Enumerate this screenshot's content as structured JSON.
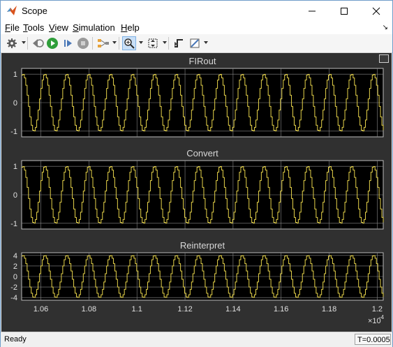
{
  "window": {
    "title": "Scope"
  },
  "menu": [
    {
      "label": "File",
      "underline": "F",
      "rest": "ile"
    },
    {
      "label": "Tools",
      "underline": "T",
      "rest": "ools"
    },
    {
      "label": "View",
      "underline": "V",
      "rest": "iew"
    },
    {
      "label": "Simulation",
      "underline": "S",
      "rest": "imulation"
    },
    {
      "label": "Help",
      "underline": "H",
      "rest": "elp"
    }
  ],
  "toolbar": {
    "icons": [
      "settings-icon",
      "step-back-icon",
      "run-icon",
      "step-forward-icon",
      "stop-icon",
      "highlight-icon",
      "zoom-in-icon",
      "autoscale-icon",
      "triggers-icon",
      "cursor-measurements-icon"
    ]
  },
  "status": {
    "text": "Ready",
    "time": "T=0.0005"
  },
  "colors": {
    "trace": "#e6d34a",
    "axes_bg": "#000000",
    "figure_bg": "#303030",
    "grid": "#8a8a8a"
  },
  "chart_data": [
    {
      "type": "line",
      "title": "FIRout",
      "yticks": [
        "1",
        "0",
        "-1"
      ],
      "ylim": [
        -1.2,
        1.2
      ],
      "amplitude": 1,
      "cycles_visible": 16.5,
      "waveform": "quantized sine"
    },
    {
      "type": "line",
      "title": "Convert",
      "yticks": [
        "1",
        "0",
        "-1"
      ],
      "ylim": [
        -1.2,
        1.2
      ],
      "amplitude": 1,
      "cycles_visible": 16.5,
      "waveform": "quantized sine"
    },
    {
      "type": "line",
      "title": "Reinterpret",
      "yticks": [
        "4",
        "2",
        "0",
        "-2",
        "-4"
      ],
      "ylim": [
        -4.5,
        4.5
      ],
      "amplitude": 4,
      "cycles_visible": 16.5,
      "waveform": "quantized sine"
    }
  ],
  "xaxis": {
    "ticks": [
      "1.06",
      "1.08",
      "1.1",
      "1.12",
      "1.14",
      "1.16",
      "1.18",
      "1.2"
    ],
    "values": [
      1.06,
      1.08,
      1.1,
      1.12,
      1.14,
      1.16,
      1.18,
      1.2
    ],
    "xlim": [
      1.052,
      1.2025
    ],
    "exponent_base": "×10",
    "exponent": "-4"
  }
}
